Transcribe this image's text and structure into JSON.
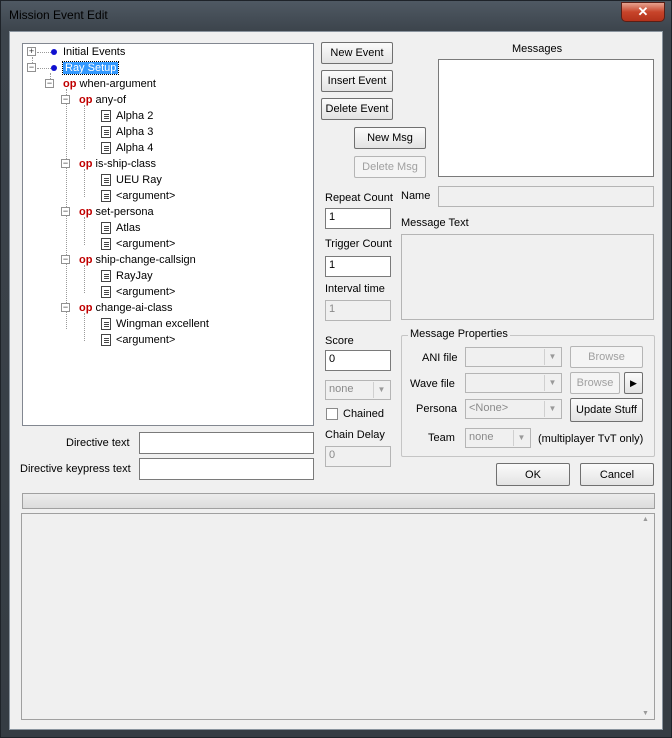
{
  "window": {
    "title": "Mission Event Edit",
    "close_glyph": "✕"
  },
  "tree": {
    "items": [
      {
        "text": "Initial Events"
      },
      {
        "text": "Ray Setup"
      },
      {
        "op": "op",
        "text": "when-argument"
      },
      {
        "op": "op",
        "text": "any-of"
      },
      {
        "text": "Alpha 2"
      },
      {
        "text": "Alpha 3"
      },
      {
        "text": "Alpha 4"
      },
      {
        "op": "op",
        "text": "is-ship-class"
      },
      {
        "text": "UEU Ray"
      },
      {
        "text": "<argument>"
      },
      {
        "op": "op",
        "text": "set-persona"
      },
      {
        "text": "Atlas"
      },
      {
        "text": "<argument>"
      },
      {
        "op": "op",
        "text": "ship-change-callsign"
      },
      {
        "text": "RayJay"
      },
      {
        "text": "<argument>"
      },
      {
        "op": "op",
        "text": "change-ai-class"
      },
      {
        "text": "Wingman excellent"
      },
      {
        "text": "<argument>"
      }
    ],
    "expand_plus": "+",
    "expand_minus": "−"
  },
  "buttons": {
    "new_event": "New Event",
    "insert_event": "Insert Event",
    "delete_event": "Delete Event",
    "new_msg": "New Msg",
    "delete_msg": "Delete Msg",
    "browse_ani": "Browse",
    "browse_wave": "Browse",
    "play": "▶",
    "update_stuff": "Update Stuff",
    "ok": "OK",
    "cancel": "Cancel"
  },
  "labels": {
    "messages": "Messages",
    "repeat_count": "Repeat Count",
    "trigger_count": "Trigger Count",
    "interval_time": "Interval time",
    "score": "Score",
    "chained": "Chained",
    "chain_delay": "Chain Delay",
    "name": "Name",
    "message_text": "Message Text",
    "message_properties": "Message Properties",
    "ani_file": "ANI file",
    "wave_file": "Wave file",
    "persona": "Persona",
    "team": "Team",
    "multiplayer_note": "(multiplayer TvT only)",
    "directive_text": "Directive text",
    "directive_keypress": "Directive keypress text"
  },
  "values": {
    "repeat_count": "1",
    "trigger_count": "1",
    "interval_time": "1",
    "score": "0",
    "chained_combo": "none",
    "chain_delay": "0",
    "persona": "<None>",
    "team": "none",
    "name": "",
    "directive_text": "",
    "directive_keypress": ""
  },
  "icons": {
    "dropdown": "▼",
    "scroll_up": "▲",
    "scroll_down": "▼"
  }
}
